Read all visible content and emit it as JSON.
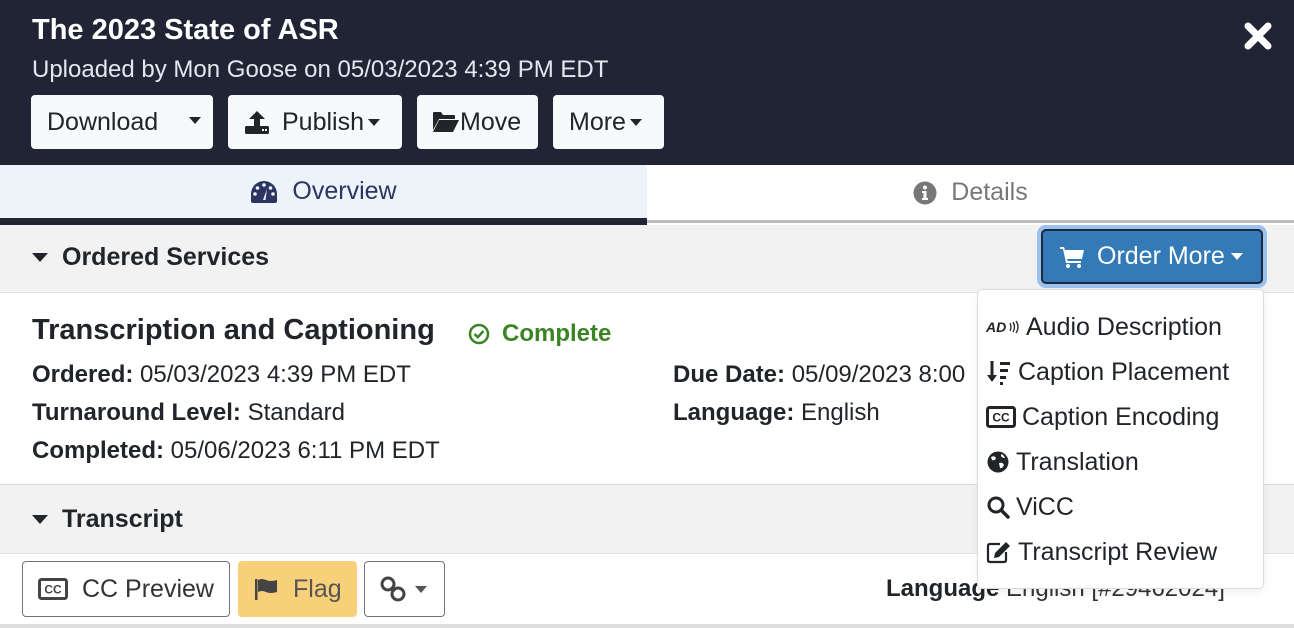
{
  "header": {
    "title": "The 2023 State of ASR",
    "subtitle": "Uploaded by Mon Goose on 05/03/2023 4:39 PM EDT",
    "buttons": {
      "download": "Download",
      "publish": "Publish",
      "move": "Move",
      "more": "More"
    },
    "close_icon": "close-icon"
  },
  "tabs": [
    {
      "label": "Overview",
      "icon": "dashboard-icon",
      "active": true
    },
    {
      "label": "Details",
      "icon": "info-icon",
      "active": false
    }
  ],
  "ordered_services": {
    "heading": "Ordered Services",
    "order_more_label": "Order More",
    "service": {
      "title": "Transcription and Captioning",
      "status": "Complete",
      "status_color": "#3b8424",
      "fields": {
        "ordered_label": "Ordered:",
        "ordered_value": "05/03/2023 4:39 PM EDT",
        "turnaround_label": "Turnaround Level:",
        "turnaround_value": "Standard",
        "completed_label": "Completed:",
        "completed_value": "05/06/2023 6:11 PM EDT",
        "due_label": "Due Date:",
        "due_value": "05/09/2023 8:00",
        "language_label": "Language:",
        "language_value": "English"
      }
    }
  },
  "order_menu": {
    "items": [
      {
        "label": "Audio Description",
        "icon": "audio-description-icon"
      },
      {
        "label": "Caption Placement",
        "icon": "caption-placement-icon"
      },
      {
        "label": "Caption Encoding",
        "icon": "closed-captioning-icon"
      },
      {
        "label": "Translation",
        "icon": "globe-icon"
      },
      {
        "label": "ViCC",
        "icon": "search-icon"
      },
      {
        "label": "Transcript Review",
        "icon": "edit-icon"
      }
    ]
  },
  "transcript": {
    "heading": "Transcript",
    "cc_preview_label": "CC Preview",
    "flag_label": "Flag",
    "language_label": "Language",
    "language_value": "English [#29462024]"
  },
  "colors": {
    "header_bg": "#212435",
    "accent_blue": "#337ab7",
    "flag_yellow": "#f8d07a",
    "active_tab_bg": "#edf4f9"
  }
}
